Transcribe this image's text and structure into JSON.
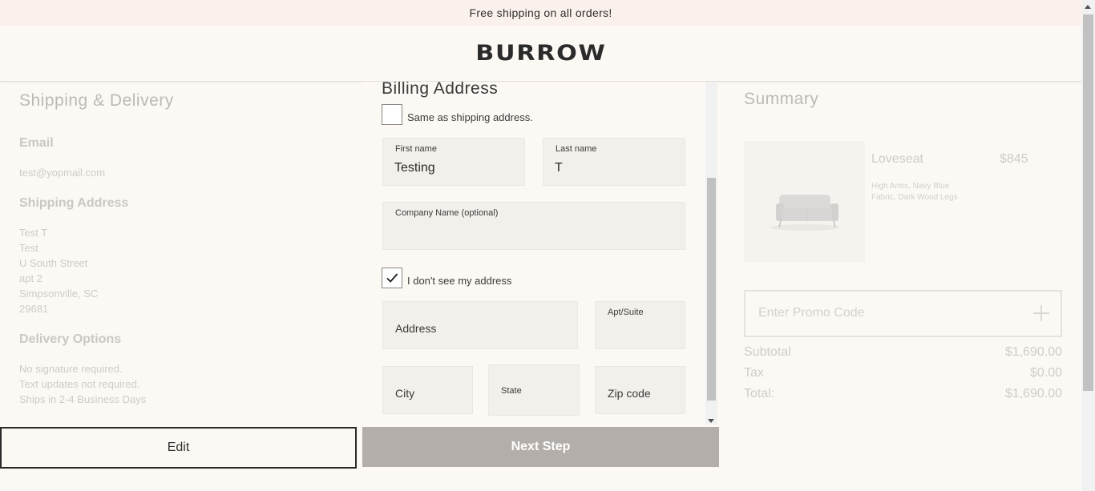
{
  "promo_bar": {
    "text": "Free shipping on all orders!"
  },
  "header": {
    "logo": "BURROW"
  },
  "shipping": {
    "title": "Shipping & Delivery",
    "email_label": "Email",
    "email_value": "test@yopmail.com",
    "address_label": "Shipping Address",
    "address_lines": [
      "Test T",
      "Test",
      "U South Street",
      "apt 2",
      "Simpsonville, SC",
      "29681"
    ],
    "delivery_label": "Delivery Options",
    "delivery_lines": [
      "No signature required.",
      "Text updates not required.",
      "Ships in 2-4 Business Days"
    ],
    "edit_label": "Edit"
  },
  "billing": {
    "title": "Billing Address",
    "same_as_shipping_label": "Same as shipping address.",
    "same_as_shipping_checked": false,
    "first_name_label": "First name",
    "first_name_value": "Testing",
    "last_name_label": "Last name",
    "last_name_value": "T",
    "company_label": "Company Name (optional)",
    "no_address_label": "I don't see my address",
    "no_address_checked": true,
    "address_placeholder": "Address",
    "apt_label": "Apt/Suite",
    "city_placeholder": "City",
    "state_label": "State",
    "zip_placeholder": "Zip code",
    "next_label": "Next Step"
  },
  "summary": {
    "title": "Summary",
    "product_name": "Loveseat",
    "product_price": "$845",
    "product_desc": "High Arms, Navy Blue Fabric, Dark Wood Legs",
    "promo_placeholder": "Enter Promo Code",
    "subtotal_label": "Subtotal",
    "subtotal_value": "$1,690.00",
    "tax_label": "Tax",
    "tax_value": "$0.00",
    "total_label": "Total:",
    "total_value": "$1,690.00"
  },
  "colors": {
    "background": "#fcf9f5",
    "promo_bar": "#fbf1ec",
    "next_button": "#b3aeaa",
    "field_bg": "#f3f0ec"
  }
}
